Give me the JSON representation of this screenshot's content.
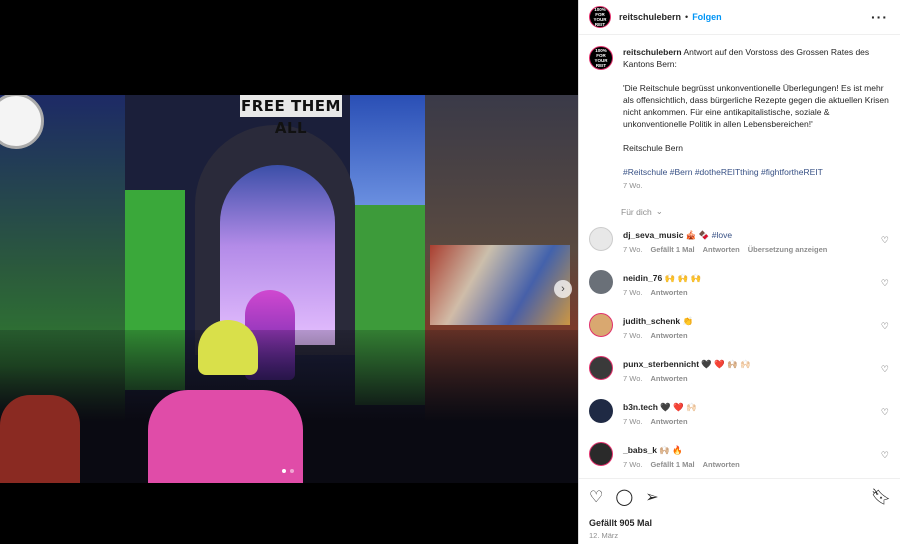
{
  "post": {
    "username": "reitschulebern",
    "follow_label": "Folgen",
    "more_icon": "more-icon",
    "avatar_text": "100% FOR YOUR REIT",
    "banner_text": "FREE THEM ALL"
  },
  "caption": {
    "username": "reitschulebern",
    "text_intro": "Antwort auf den Vorstoss des Grossen Rates des Kantons Bern:",
    "quote": "'Die Reitschule begrüsst unkonventionelle Überlegungen! Es ist mehr als offensichtlich, dass bürgerliche Rezepte gegen die aktuellen Krisen nicht ankommen. Für eine antikapitalistische, soziale & unkonventionelle Politik in allen Lebensbereichen!'",
    "signature": "Reitschule Bern",
    "hashtags": "#Reitschule #Bern #dotheREITthing #fightfortheREIT",
    "time": "7 Wo."
  },
  "fur_dich_label": "Für dich",
  "comments": [
    {
      "username": "dj_seva_music",
      "text": "🎪 🍫",
      "hashtag": "#love",
      "time": "7 Wo.",
      "likes": "Gefällt 1 Mal",
      "reply": "Antworten",
      "translate": "Übersetzung anzeigen",
      "avatar_color": "#e8e8e8"
    },
    {
      "username": "neidin_76",
      "text": "🙌 🙌 🙌",
      "time": "7 Wo.",
      "reply": "Antworten",
      "avatar_color": "#6a7078"
    },
    {
      "username": "judith_schenk",
      "text": "👏",
      "time": "7 Wo.",
      "reply": "Antworten",
      "avatar_color": "#d9a870"
    },
    {
      "username": "punx_sterbennicht",
      "text": "🖤 ❤️ 🙌🏼 🙌🏻",
      "time": "7 Wo.",
      "reply": "Antworten",
      "avatar_color": "#3a3a3a"
    },
    {
      "username": "b3n.tech",
      "text": "🖤 ❤️ 🙌🏻",
      "time": "7 Wo.",
      "reply": "Antworten",
      "avatar_color": "#1f2a44"
    },
    {
      "username": "_babs_k",
      "text": "🙌🏼 🔥",
      "time": "7 Wo.",
      "likes": "Gefällt 1 Mal",
      "reply": "Antworten",
      "avatar_color": "#2a2a2a"
    }
  ],
  "actions": {
    "likes": "Gefällt 905 Mal",
    "date": "12. März"
  }
}
